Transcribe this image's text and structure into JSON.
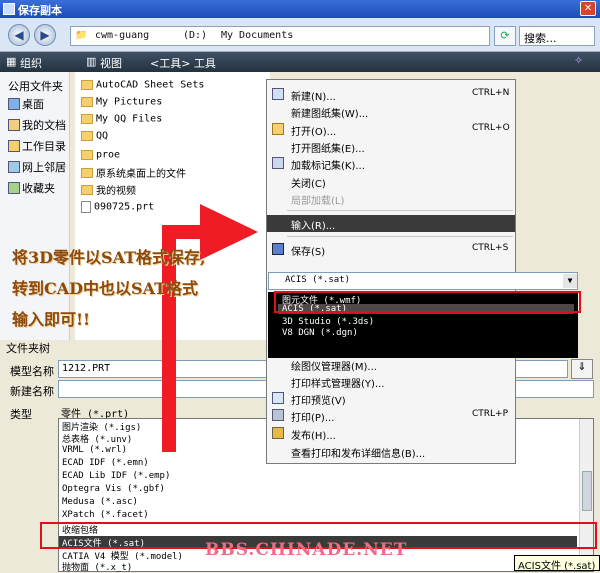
{
  "window": {
    "title": "保存副本"
  },
  "address": {
    "seg1": "cwm-guang",
    "seg2": "(D:)",
    "seg3": "My Documents",
    "search_placeholder": "搜索..."
  },
  "toolbar": {
    "organize": "组织",
    "view": "视图",
    "tools": "<工具> 工具"
  },
  "sidebar": {
    "header": "公用文件夹",
    "items": [
      {
        "label": "桌面",
        "icon": "desktop-icon"
      },
      {
        "label": "我的文档",
        "icon": "documents-icon"
      },
      {
        "label": "工作目录",
        "icon": "workdir-icon"
      },
      {
        "label": "网上邻居",
        "icon": "network-icon"
      },
      {
        "label": "收藏夹",
        "icon": "favorites-icon"
      }
    ]
  },
  "files": [
    {
      "name": "AutoCAD Sheet Sets",
      "type": "folder"
    },
    {
      "name": "My Pictures",
      "type": "folder"
    },
    {
      "name": "My QQ Files",
      "type": "folder"
    },
    {
      "name": "QQ",
      "type": "folder"
    },
    {
      "name": "proe",
      "type": "folder"
    },
    {
      "name": "原系统桌面上的文件",
      "type": "folder"
    },
    {
      "name": "我的视频",
      "type": "folder"
    },
    {
      "name": "090725.prt",
      "type": "file"
    }
  ],
  "lower": {
    "folders_toggle": "文件夹树",
    "model_name_label": "模型名称",
    "model_name_value": "1212.PRT",
    "new_name_label": "新建名称",
    "new_name_value": "",
    "type_label": "类型",
    "type_value": "零件 (*.prt)"
  },
  "type_options": [
    "图片渲染 (*.igs)",
    "总表格 (*.unv)",
    "VRML (*.wrl)",
    "ECAD IDF (*.emn)",
    "ECAD Lib IDF (*.emp)",
    "Optegra Vis (*.gbf)",
    "Medusa (*.asc)",
    "XPatch (*.facet)",
    "收缩包络",
    "ACIS文件 (*.sat)",
    "CATIA V4 模型 (*.model)",
    "抛物面 (*.x_t)"
  ],
  "type_selected_index": 9,
  "context_menu": [
    {
      "label": "新建(N)...",
      "shortcut": "CTRL+N",
      "icon": "new-icon",
      "state": "normal"
    },
    {
      "label": "新建图纸集(W)...",
      "shortcut": "",
      "icon": "",
      "state": "normal"
    },
    {
      "label": "打开(O)...",
      "shortcut": "CTRL+O",
      "icon": "open-icon",
      "state": "normal"
    },
    {
      "label": "打开图纸集(E)...",
      "shortcut": "",
      "icon": "",
      "state": "normal"
    },
    {
      "label": "加载标记集(K)...",
      "shortcut": "",
      "icon": "markup-icon",
      "state": "normal"
    },
    {
      "label": "关闭(C)",
      "shortcut": "",
      "icon": "",
      "state": "normal"
    },
    {
      "label": "局部加载(L)",
      "shortcut": "",
      "icon": "",
      "state": "disabled"
    },
    {
      "label": "输入(R)...",
      "shortcut": "",
      "icon": "",
      "state": "highlighted"
    },
    {
      "label": "保存(S)",
      "shortcut": "CTRL+S",
      "icon": "save-icon",
      "state": "normal"
    },
    {
      "label": "绘图仪管理器(M)...",
      "shortcut": "",
      "icon": "",
      "state": "normal"
    },
    {
      "label": "打印样式管理器(Y)...",
      "shortcut": "",
      "icon": "",
      "state": "normal"
    },
    {
      "label": "打印预览(V)",
      "shortcut": "",
      "icon": "preview-icon",
      "state": "normal"
    },
    {
      "label": "打印(P)...",
      "shortcut": "CTRL+P",
      "icon": "print-icon",
      "state": "normal"
    },
    {
      "label": "发布(H)...",
      "shortcut": "",
      "icon": "publish-icon",
      "state": "normal"
    },
    {
      "label": "查看打印和发布详细信息(B)...",
      "shortcut": "",
      "icon": "",
      "state": "normal"
    }
  ],
  "format_dropdown": {
    "value": "ACIS (*.sat)",
    "options": [
      "图元文件 (*.wmf)",
      "ACIS (*.sat)",
      "3D Studio (*.3ds)",
      "V8 DGN (*.dgn)"
    ],
    "selected_index": 1
  },
  "annotation": {
    "line1": "将3D零件以SAT格式保存,",
    "line2": "转到CAD中也以SAT格式",
    "line3": "输入即可!!"
  },
  "watermark": "BBS.CHINADE.NET",
  "tooltip": "ACIS文件 (*.sat)",
  "colors": {
    "highlight": "#3a3a3a",
    "red_marker": "#e0101a",
    "annotation": "#8b4a10",
    "watermark": "#f36a86"
  }
}
